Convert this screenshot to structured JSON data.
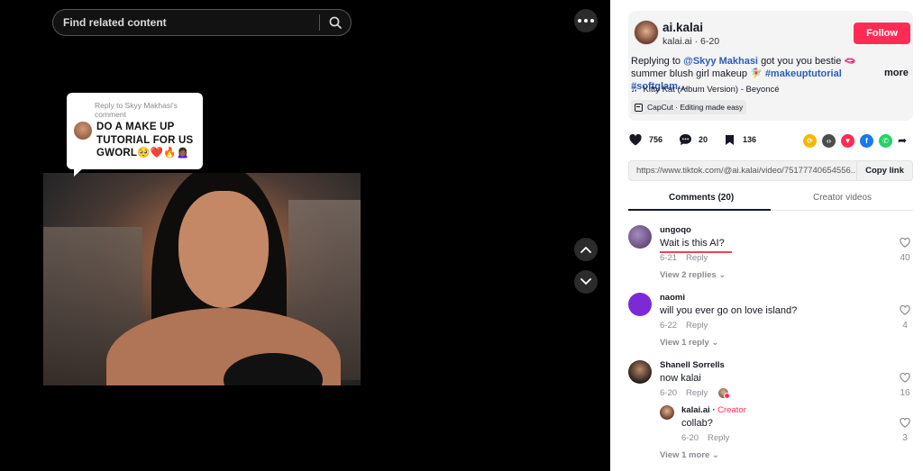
{
  "search": {
    "placeholder": "Find related content"
  },
  "overlay_reply": {
    "header": "Reply to Skyy Makhasi's comment",
    "text": "DO A MAKE UP TUTORIAL FOR US GWORL🥺❤️🔥🙍🏾‍♀️"
  },
  "author": {
    "name": "ai.kalai",
    "handle": "kalai.ai",
    "date": "6-20",
    "follow_label": "Follow"
  },
  "description": {
    "prefix": "Replying to",
    "mention": "@Skyy Makhasi",
    "body": "got you you bestie 🫦 summer blush girl makeup 🧚‍♀️",
    "tags": "#makeuptutorial #softglam…",
    "more_label": "more"
  },
  "music": {
    "title": "Kitty Kat (Album Version) - Beyoncé"
  },
  "capcut": {
    "label": "CapCut · Editing made easy"
  },
  "actions": {
    "likes": "756",
    "comments": "20",
    "saves": "136"
  },
  "share_colors": [
    "#f5b800",
    "#4d4d4d",
    "#fe2c55",
    "#1877f2",
    "#25d366"
  ],
  "link": {
    "url": "https://www.tiktok.com/@ai.kalai/video/75177740654556...",
    "copy_label": "Copy link"
  },
  "tabs": {
    "comments": "Comments (20)",
    "creator": "Creator videos"
  },
  "comments": [
    {
      "user": "ungoqo",
      "text": "Wait is this AI?",
      "date": "6-21",
      "reply_label": "Reply",
      "likes": "40",
      "view_replies": "View 2 replies",
      "avatar_color": "#6f4e86"
    },
    {
      "user": "naomi",
      "text": "will you ever go on love island?",
      "date": "6-22",
      "reply_label": "Reply",
      "likes": "4",
      "view_replies": "View 1 reply",
      "avatar_color": "#7b2ad6"
    },
    {
      "user": "Shanell Sorrells",
      "text": "now kalai",
      "date": "6-20",
      "reply_label": "Reply",
      "likes": "16",
      "view_replies": "View 1 more",
      "avatar_color": "#3a2a24"
    }
  ],
  "nested_reply": {
    "user": "kalai.ai",
    "creator_label": "Creator",
    "text": "collab?",
    "date": "6-20",
    "reply_label": "Reply",
    "likes": "3"
  }
}
